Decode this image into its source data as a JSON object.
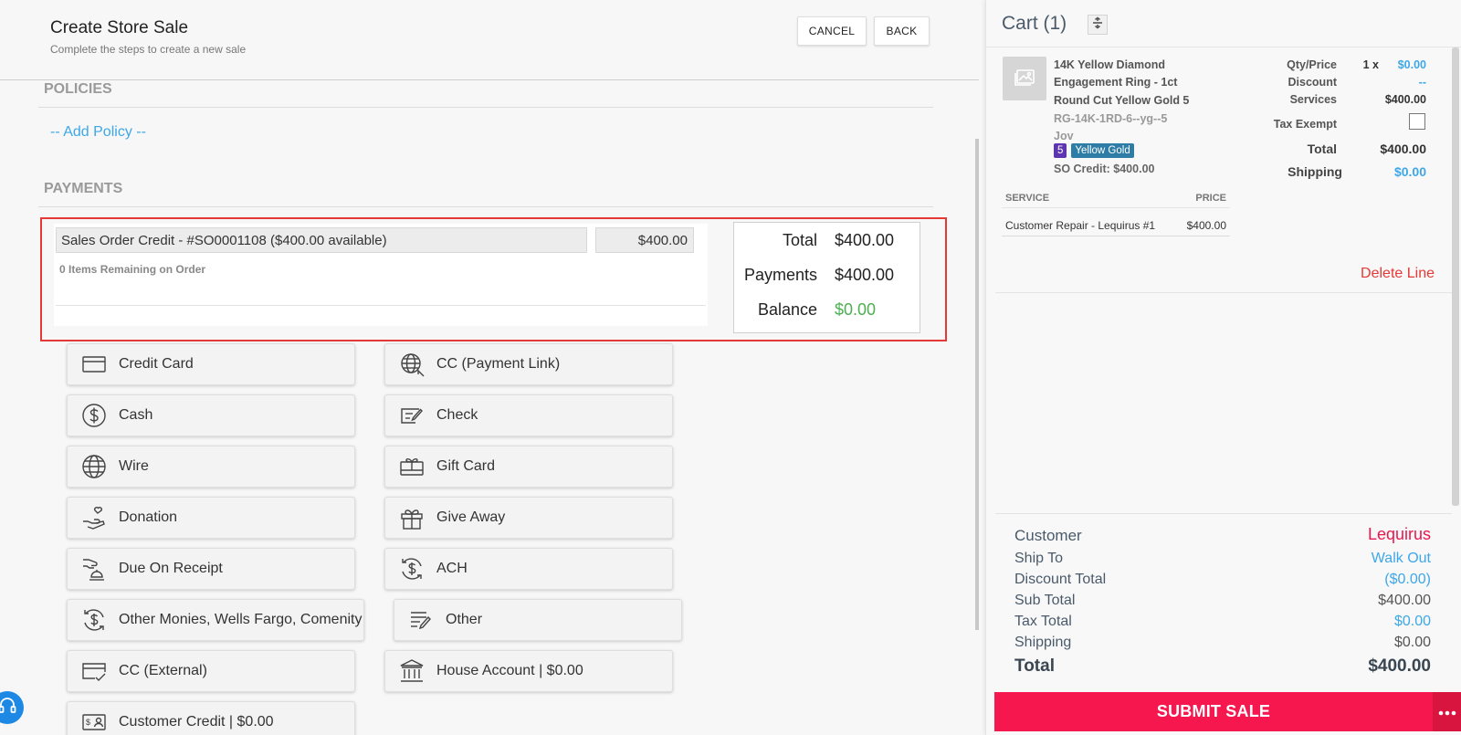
{
  "header": {
    "title": "Create Store Sale",
    "subtitle": "Complete the steps to create a new sale",
    "cancel_label": "CANCEL",
    "back_label": "BACK"
  },
  "policies": {
    "title": "POLICIES",
    "add_label": "-- Add Policy --"
  },
  "payments": {
    "title": "PAYMENTS",
    "line": {
      "name": "Sales Order Credit - #SO0001108 ($400.00 available)",
      "amount": "$400.00",
      "note": "0 Items Remaining on Order"
    },
    "totals": {
      "total_label": "Total",
      "total_value": "$400.00",
      "payments_label": "Payments",
      "payments_value": "$400.00",
      "balance_label": "Balance",
      "balance_value": "$0.00"
    },
    "methods": [
      {
        "label": "Credit Card",
        "icon": "credit-card-icon"
      },
      {
        "label": "CC (Payment Link)",
        "icon": "globe-link-icon"
      },
      {
        "label": "Cash",
        "icon": "dollar-circle-icon"
      },
      {
        "label": "Check",
        "icon": "check-icon"
      },
      {
        "label": "Wire",
        "icon": "globe-icon"
      },
      {
        "label": "Gift Card",
        "icon": "gift-card-icon"
      },
      {
        "label": "Donation",
        "icon": "donation-icon"
      },
      {
        "label": "Give Away",
        "icon": "gift-icon"
      },
      {
        "label": "Due On Receipt",
        "icon": "hand-bell-icon"
      },
      {
        "label": "ACH",
        "icon": "dollar-cycle-icon"
      },
      {
        "label": "Other Monies, Wells Fargo, Comenity",
        "icon": "dollar-cycle-icon"
      },
      {
        "label": "Other",
        "icon": "list-pen-icon"
      },
      {
        "label": "CC (External)",
        "icon": "card-check-icon"
      },
      {
        "label": "House Account | $0.00",
        "icon": "bank-icon"
      },
      {
        "label": "Customer Credit | $0.00",
        "icon": "id-card-icon"
      }
    ]
  },
  "cart": {
    "title": "Cart (1)",
    "item": {
      "name": "14K Yellow Diamond Engagement Ring - 1ct Round Cut Yellow Gold 5",
      "sku": "RG-14K-1RD-6--yg--5",
      "vendor": "Jov",
      "badge_size": "5",
      "badge_metal": "Yellow Gold",
      "so_credit": "SO Credit: $400.00",
      "qty_price_label": "Qty/Price",
      "qty": "1 x",
      "price": "$0.00",
      "discount_label": "Discount",
      "discount_value": "--",
      "services_label": "Services",
      "services_value": "$400.00",
      "tax_exempt_label": "Tax Exempt",
      "total_label": "Total",
      "total_value": "$400.00",
      "shipping_label": "Shipping",
      "shipping_value": "$0.00"
    },
    "services": {
      "col_service": "SERVICE",
      "col_price": "PRICE",
      "rows": [
        {
          "service": "Customer Repair - Lequirus #1",
          "price": "$400.00"
        }
      ]
    },
    "delete_label": "Delete Line",
    "summary": {
      "customer_label": "Customer",
      "customer_value": "Lequirus",
      "ship_to_label": "Ship To",
      "ship_to_value": "Walk Out",
      "discount_total_label": "Discount Total",
      "discount_total_value": "($0.00)",
      "sub_total_label": "Sub Total",
      "sub_total_value": "$400.00",
      "tax_total_label": "Tax Total",
      "tax_total_value": "$0.00",
      "shipping_label": "Shipping",
      "shipping_value": "$0.00",
      "total_label": "Total",
      "total_value": "$400.00"
    },
    "submit_label": "SUBMIT SALE"
  },
  "colors": {
    "accent_blue": "#3ea7e8",
    "submit_red": "#f7174f",
    "highlight_border": "#e53935",
    "balance_green": "#4caf50"
  }
}
